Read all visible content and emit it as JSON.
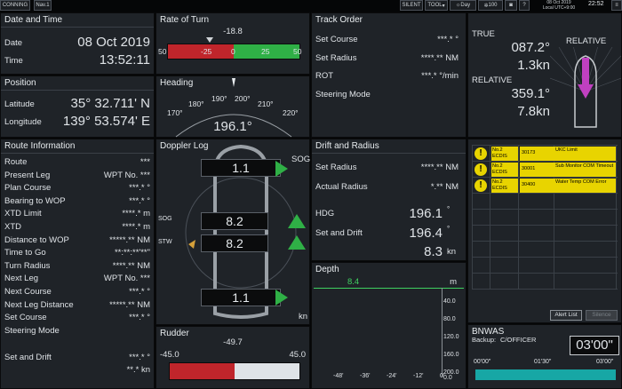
{
  "topbar": {
    "mode": "CONNING",
    "nav": "Nav.1",
    "silent": "SILENT",
    "tool": "TOOL",
    "day": "Day",
    "brightness": "100",
    "time": "22:52",
    "date": "08 Oct 2019",
    "utc": "Local UTC+9:00"
  },
  "datetime": {
    "title": "Date and Time",
    "date_label": "Date",
    "date": "08 Oct 2019",
    "time_label": "Time",
    "time": "13:52:11"
  },
  "position": {
    "title": "Position",
    "lat_label": "Latitude",
    "lat": "35° 32.711' N",
    "lon_label": "Longitude",
    "lon": "139° 53.574' E"
  },
  "route": {
    "title": "Route Information",
    "rows": [
      {
        "label": "Route",
        "value": "***"
      },
      {
        "label": "Present Leg",
        "value": "WPT No. ***"
      },
      {
        "label": "Plan Course",
        "value": "***.* °"
      },
      {
        "label": "Bearing to WOP",
        "value": "***.* °"
      },
      {
        "label": "XTD Limit",
        "value": "****.* m"
      },
      {
        "label": "XTD",
        "value": "****.* m"
      },
      {
        "label": "Distance to WOP",
        "value": "*****.** NM"
      },
      {
        "label": "Time to Go",
        "value": "**:**:**'**\""
      },
      {
        "label": "Turn Radius",
        "value": "****.** NM"
      },
      {
        "label": "Next Leg",
        "value": "WPT No. ***"
      },
      {
        "label": "Next Course",
        "value": "***.* °"
      },
      {
        "label": "Next Leg Distance",
        "value": "*****.** NM"
      },
      {
        "label": "Set Course",
        "value": "***.* °"
      },
      {
        "label": "Steering Mode",
        "value": ""
      },
      {
        "label": "Set and Drift",
        "value": "***.* °"
      },
      {
        "label": "",
        "value": "**.* kn"
      }
    ]
  },
  "rot": {
    "title": "Rate of Turn",
    "value": "-18.8",
    "ticks": [
      "50",
      "-25",
      "0",
      "25",
      "50"
    ],
    "fraction": -0.376
  },
  "heading": {
    "title": "Heading",
    "value": "196.1°",
    "ticks": [
      "170°",
      "180°",
      "190°",
      "200°",
      "210°",
      "220°"
    ]
  },
  "doppler": {
    "title": "Doppler Log",
    "sog_label": "SOG",
    "stw_label": "STW",
    "bow": "1.1",
    "sog": "8.2",
    "stw": "8.2",
    "stern": "1.1",
    "unit": "kn"
  },
  "rudder": {
    "title": "Rudder",
    "value": "-49.7",
    "left": "-45.0",
    "right": "45.0",
    "fraction": -1.0
  },
  "track": {
    "title": "Track Order",
    "rows": [
      {
        "label": "Set Course",
        "value": "***.* °"
      },
      {
        "label": "Set Radius",
        "value": "****.** NM"
      },
      {
        "label": "ROT",
        "value": "***.* °/min"
      },
      {
        "label": "Steering Mode",
        "value": ""
      }
    ]
  },
  "drift": {
    "title": "Drift and Radius",
    "set_radius_label": "Set Radius",
    "set_radius": "****.** NM",
    "actual_radius_label": "Actual Radius",
    "actual_radius": "*.** NM",
    "hdg_label": "HDG",
    "hdg": "196.1",
    "set_drift_label": "Set and Drift",
    "set_drift": "196.4",
    "speed": "8.3",
    "speed_unit": "kn"
  },
  "depth": {
    "title": "Depth",
    "value": "8.4",
    "unit": "m",
    "scale": [
      "40.0",
      "80.0",
      "120.0",
      "160.0",
      "200.0",
      "0.0"
    ],
    "hours": [
      "-48'",
      "-36'",
      "-24'",
      "-12'",
      "0'"
    ]
  },
  "wind": {
    "true_label": "TRUE",
    "true_dir": "087.2°",
    "true_speed": "1.3kn",
    "rel_label": "RELATIVE",
    "rel_dir": "359.1°",
    "rel_speed": "7.8kn",
    "view_label": "RELATIVE"
  },
  "alerts": {
    "items": [
      {
        "source": "No.2 ECDIS",
        "code": "30173",
        "message": "UKC Limit"
      },
      {
        "source": "No.2 ECDIS",
        "code": "30001",
        "message": "Sub Monitor COM Timeout"
      },
      {
        "source": "No.2 ECDIS",
        "code": "30400",
        "message": "Water Temp COM Error"
      }
    ],
    "list_button": "Alert List",
    "silence_button": "Silence"
  },
  "bnwas": {
    "title": "BNWAS",
    "backup_label": "Backup:",
    "backup": "C/OFFICER",
    "timer": "03'00\"",
    "scale": [
      "00'00\"",
      "01'30\"",
      "03'00\""
    ],
    "fraction": 1.0
  },
  "colors": {
    "panel": "#1f2328",
    "red": "#c0252b",
    "green": "#2fb046",
    "magenta": "#c040c0",
    "teal": "#17a7a5",
    "alert_yellow": "#e8d400"
  }
}
